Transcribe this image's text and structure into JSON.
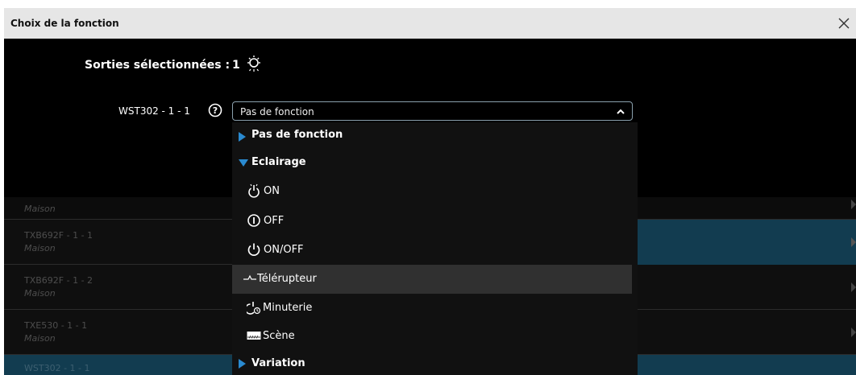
{
  "window": {
    "title": "Choix de la fonction"
  },
  "summary": {
    "label": "Sorties sélectionnées :",
    "count": "1",
    "icon": "light-bulb-icon"
  },
  "output": {
    "name": "WST302 - 1 - 1",
    "help_icon": "help-icon"
  },
  "function_select": {
    "value": "Pas de fonction",
    "expanded": true
  },
  "dropdown": {
    "items": [
      {
        "type": "group",
        "label": "Pas de fonction",
        "expanded": false
      },
      {
        "type": "group",
        "label": "Eclairage",
        "expanded": true
      },
      {
        "type": "option",
        "label": "ON",
        "icon": "power-on-icon"
      },
      {
        "type": "option",
        "label": "OFF",
        "icon": "power-off-icon"
      },
      {
        "type": "option",
        "label": "ON/OFF",
        "icon": "power-toggle-icon"
      },
      {
        "type": "option",
        "label": "Télérupteur",
        "icon": "impulse-relay-icon",
        "highlighted": true
      },
      {
        "type": "option",
        "label": "Minuterie",
        "icon": "timer-icon"
      },
      {
        "type": "option",
        "label": "Scène",
        "icon": "scene-icon"
      },
      {
        "type": "group",
        "label": "Variation",
        "expanded": false
      }
    ]
  },
  "background_list": {
    "rows": [
      {
        "name": "",
        "location": "Maison"
      },
      {
        "name": "TXB692F - 1 - 1",
        "location": "Maison",
        "selected": true
      },
      {
        "name": "TXB692F - 1 - 2",
        "location": "Maison"
      },
      {
        "name": "TXE530 - 1 - 1",
        "location": "Maison"
      },
      {
        "name": "WST302 - 1 - 1",
        "location": "",
        "selected": true
      }
    ]
  },
  "colors": {
    "title_bar": "#e6e6e6",
    "content_bg": "#000000",
    "menu_bg": "#111111",
    "menu_highlight": "#303030",
    "group_triangle": "#2a8ad0",
    "row_selected": "#123c50"
  }
}
